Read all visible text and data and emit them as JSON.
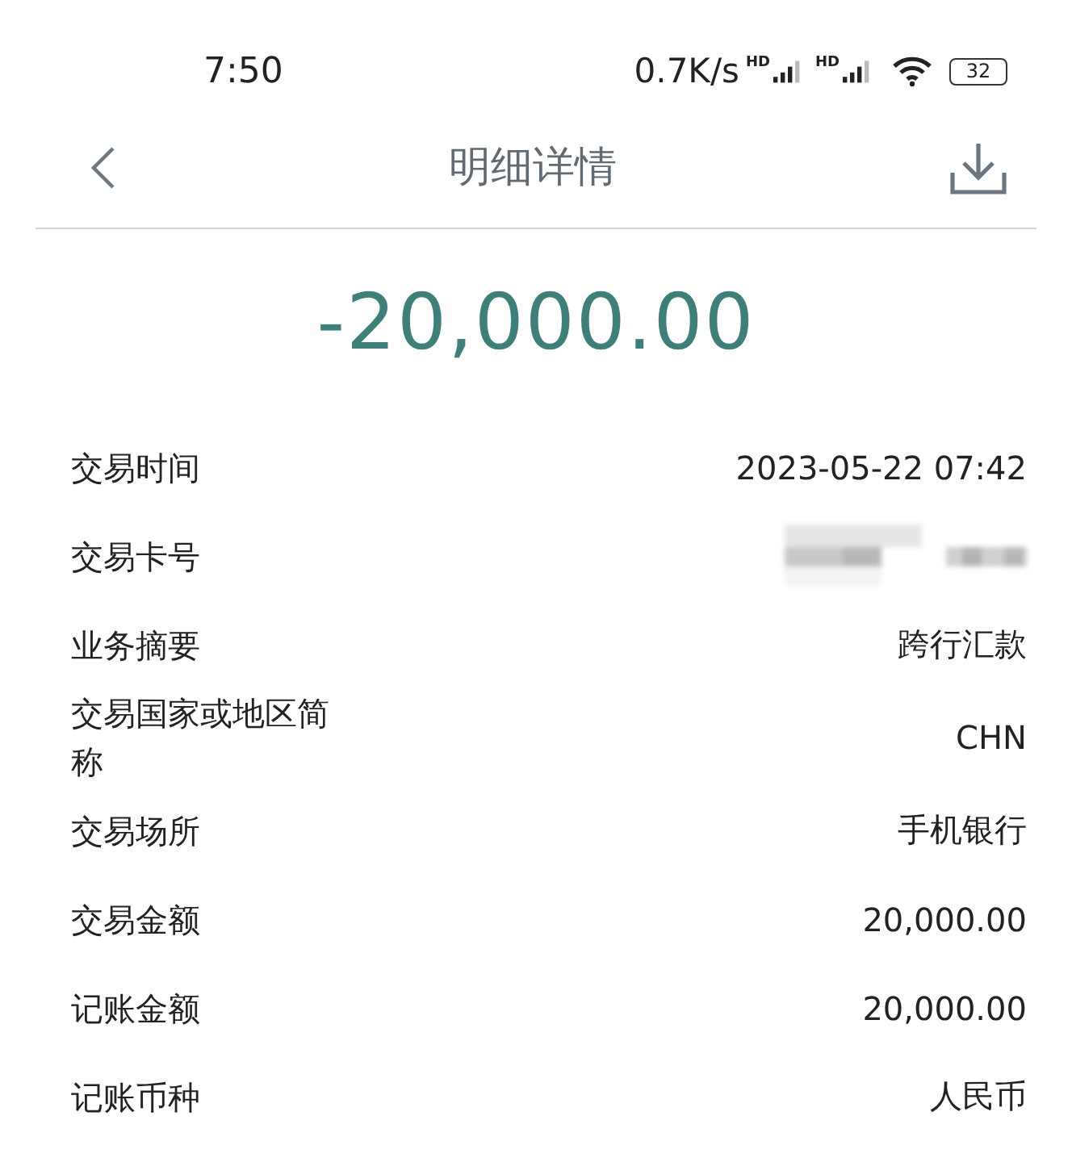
{
  "status_bar": {
    "time": "7:50",
    "speed": "0.7K/s",
    "signal_label_1": "HD",
    "signal_label_2": "HD",
    "battery": "32"
  },
  "header": {
    "title": "明细详情"
  },
  "amount": "-20,000.00",
  "details": [
    {
      "label": "交易时间",
      "kind": "text",
      "value": "2023-05-22 07:42"
    },
    {
      "label": "交易卡号",
      "kind": "redacted"
    },
    {
      "label": "业务摘要",
      "kind": "text",
      "value": "跨行汇款"
    },
    {
      "label": "交易国家或地区简称",
      "kind": "text",
      "value": "CHN"
    },
    {
      "label": "交易场所",
      "kind": "text",
      "value": "手机银行"
    },
    {
      "label": "交易金额",
      "kind": "text",
      "value": "20,000.00"
    },
    {
      "label": "记账金额",
      "kind": "text",
      "value": "20,000.00"
    },
    {
      "label": "记账币种",
      "kind": "text",
      "value": "人民币"
    }
  ]
}
